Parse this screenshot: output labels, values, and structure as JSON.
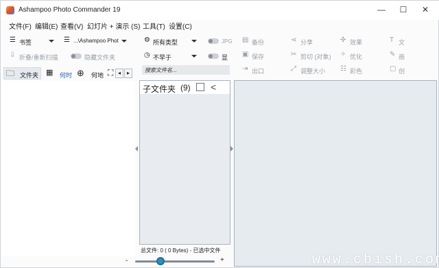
{
  "window": {
    "title": "Ashampoo Photo Commander 19",
    "controls": {
      "minimize": "—",
      "maximize": "☐",
      "close": "✕"
    }
  },
  "menu": [
    {
      "label": "文件(F)"
    },
    {
      "label": "编辑(E)"
    },
    {
      "label": "查看(V)"
    },
    {
      "label": "幻灯片 + 演示 (S)"
    },
    {
      "label": "工具(T)"
    },
    {
      "label": "设置(C)"
    }
  ],
  "left_toolbar": {
    "bookmarks": "书签",
    "path": "...\\Ashampoo Phot",
    "refresh": "折叠/重新扫描",
    "hide_folders": "隐藏文件夹"
  },
  "tabs": [
    {
      "label": "文件夹"
    },
    {
      "label": "何时"
    },
    {
      "label": "何地"
    }
  ],
  "filter_toolbar": {
    "types": "所有类型",
    "date": "不早于",
    "jpg_toggle": "JPG",
    "show_toggle": "显",
    "search_placeholder": "搜索文件名..."
  },
  "actions": {
    "col1": [
      "备份",
      "保存",
      "出口"
    ],
    "col2": [
      "分享",
      "剪切 (对象)",
      "调整大小"
    ],
    "col3": [
      "效果",
      "优化",
      "彩色"
    ],
    "col4": [
      "文",
      "画",
      "创"
    ]
  },
  "subfolder": {
    "label": "子文件夹",
    "count": "(9)",
    "collapse_glyph": "<"
  },
  "status": {
    "text": "总文件: 0 (    0 Bytes) - 已选中文件"
  },
  "zoom": {
    "minus": "-",
    "plus": "+"
  },
  "watermark": "www.cbish.com"
}
